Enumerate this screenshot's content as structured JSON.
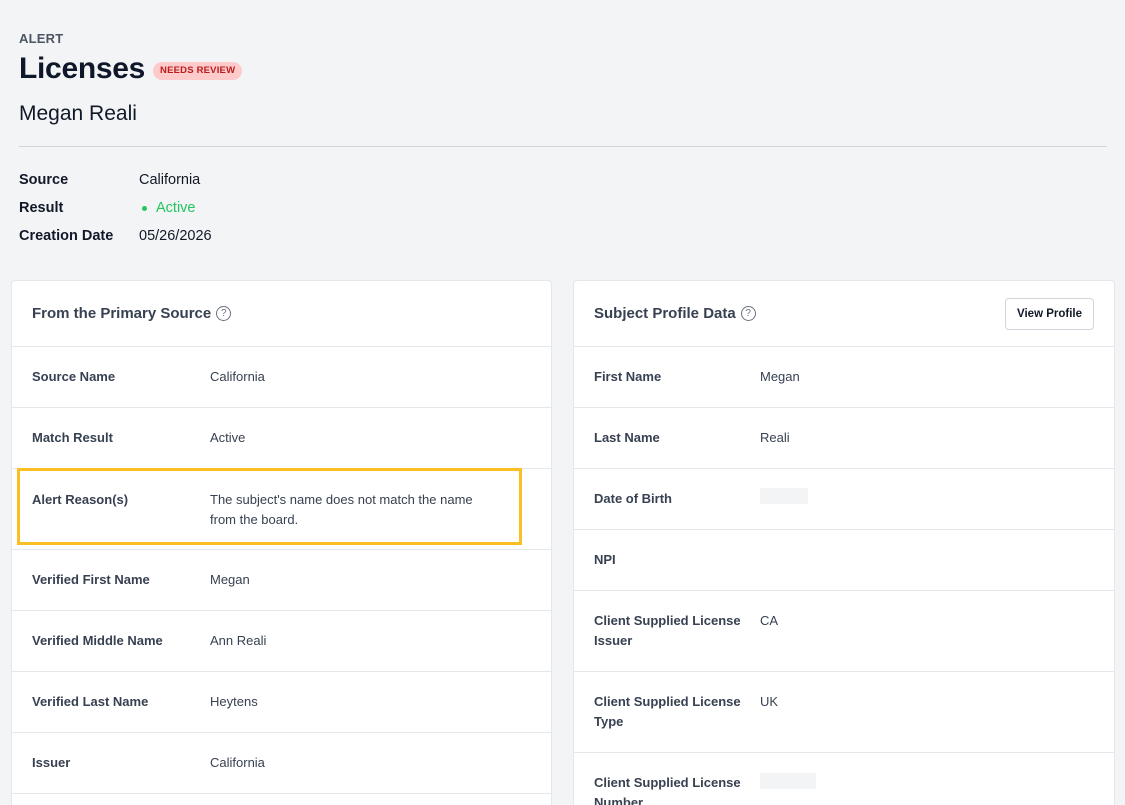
{
  "header": {
    "eyebrow": "ALERT",
    "title": "Licenses",
    "badge": "NEEDS REVIEW",
    "subject_name": "Megan Reali"
  },
  "meta": {
    "source_label": "Source",
    "source_value": "California",
    "result_label": "Result",
    "result_value": "Active",
    "creation_label": "Creation Date",
    "creation_value": "05/26/2026"
  },
  "primary_source": {
    "title": "From the Primary Source",
    "rows": [
      {
        "label": "Source Name",
        "value": "California"
      },
      {
        "label": "Match Result",
        "value": "Active"
      },
      {
        "label": "Alert Reason(s)",
        "value": "The subject's name does not match the name from the board."
      },
      {
        "label": "Verified First Name",
        "value": "Megan"
      },
      {
        "label": "Verified Middle Name",
        "value": "Ann Reali"
      },
      {
        "label": "Verified Last Name",
        "value": "Heytens"
      },
      {
        "label": "Issuer",
        "value": "California"
      }
    ]
  },
  "subject_profile": {
    "title": "Subject Profile Data",
    "view_profile_label": "View Profile",
    "rows": [
      {
        "label": "First Name",
        "value": "Megan"
      },
      {
        "label": "Last Name",
        "value": "Reali"
      },
      {
        "label": "Date of Birth",
        "value": ""
      },
      {
        "label": "NPI",
        "value": ""
      },
      {
        "label": "Client Supplied License Issuer",
        "value": "CA"
      },
      {
        "label": "Client Supplied License Type",
        "value": "UK"
      },
      {
        "label": "Client Supplied License Number",
        "value": ""
      }
    ]
  },
  "colors": {
    "accent_active": "#22c55e",
    "badge_bg": "#fecaca",
    "badge_text": "#b91c1c",
    "highlight": "#fbbf24"
  },
  "icons": [
    "help-circle-icon",
    "status-dot-icon"
  ]
}
